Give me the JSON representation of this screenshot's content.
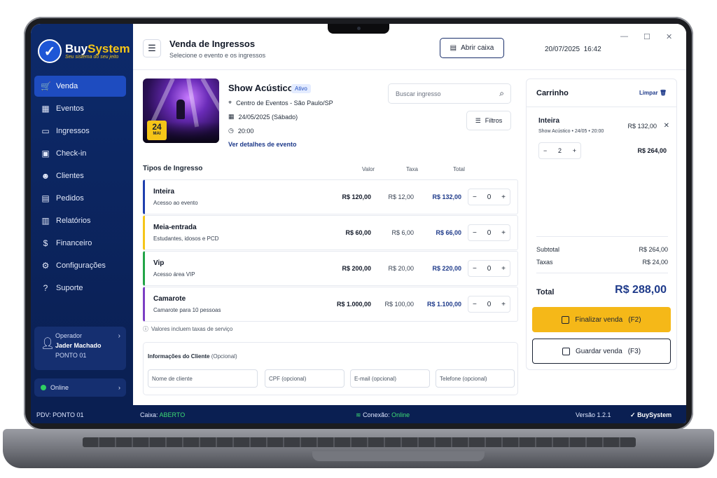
{
  "brand": {
    "name_part1": "Buy",
    "name_part2": "System",
    "tagline": "Seu sistema do seu jeito"
  },
  "sidebar": {
    "items": [
      {
        "label": "Venda",
        "icon": "cart-icon",
        "glyph": "🛒"
      },
      {
        "label": "Eventos",
        "icon": "calendar-plus-icon",
        "glyph": "▦"
      },
      {
        "label": "Ingressos",
        "icon": "ticket-icon",
        "glyph": "▭"
      },
      {
        "label": "Check-in",
        "icon": "checkin-icon",
        "glyph": "▣"
      },
      {
        "label": "Clientes",
        "icon": "users-icon",
        "glyph": "☻"
      },
      {
        "label": "Pedidos",
        "icon": "clipboard-icon",
        "glyph": "▤"
      },
      {
        "label": "Relatórios",
        "icon": "bar-chart-icon",
        "glyph": "▥"
      },
      {
        "label": "Financeiro",
        "icon": "dollar-icon",
        "glyph": "$"
      },
      {
        "label": "Configurações",
        "icon": "gear-icon",
        "glyph": "⚙"
      },
      {
        "label": "Suporte",
        "icon": "help-icon",
        "glyph": "?"
      }
    ],
    "active": "Venda",
    "operator": {
      "label": "Operador",
      "name": "Jader Machado",
      "station": "PONTO 01"
    },
    "status": "Online"
  },
  "header": {
    "title": "Venda de Ingressos",
    "subtitle": "Selecione o evento e os ingressos",
    "open_cash_label": "Abrir caixa",
    "date": "20/07/2025",
    "time": "16:42"
  },
  "event": {
    "title": "Show Acústico",
    "status": "Ativo",
    "badge_day": "24",
    "badge_month": "MAI",
    "venue": "Centro de Eventos - São Paulo/SP",
    "date": "24/05/2025 (Sábado)",
    "time": "20:00",
    "details_link": "Ver detalhes de evento"
  },
  "search": {
    "placeholder": "Buscar ingresso"
  },
  "filters_label": "Filtros",
  "tickets": {
    "section_title": "Tipos de Ingresso",
    "columns": {
      "value": "Valor",
      "fee": "Taxa",
      "total": "Total"
    },
    "rows": [
      {
        "name": "Inteira",
        "desc": "Acesso ao evento",
        "value": "R$ 120,00",
        "fee": "R$ 12,00",
        "total": "R$ 132,00",
        "qty": "0",
        "color": "#1e3fae"
      },
      {
        "name": "Meia-entrada",
        "desc": "Estudantes, idosos e PCD",
        "value": "R$ 60,00",
        "fee": "R$ 6,00",
        "total": "R$ 66,00",
        "qty": "0",
        "color": "#f5c518"
      },
      {
        "name": "Vip",
        "desc": "Acesso área VIP",
        "value": "R$ 200,00",
        "fee": "R$ 20,00",
        "total": "R$ 220,00",
        "qty": "0",
        "color": "#22a447"
      },
      {
        "name": "Camarote",
        "desc": "Camarote para 10 pessoas",
        "value": "R$ 1.000,00",
        "fee": "R$ 100,00",
        "total": "R$ 1.100,00",
        "qty": "0",
        "color": "#7b3fc4"
      }
    ],
    "note": "Valores incluem taxas de serviço"
  },
  "client": {
    "title": "Informações do Cliente",
    "optional": "(Opcional)",
    "fields": [
      "Nome de cliente",
      "CPF (opcional)",
      "E-mail (opcional)",
      "Telefone (opcional)"
    ]
  },
  "cart": {
    "title": "Carrinho",
    "clear_label": "Limpar",
    "item": {
      "name": "Inteira",
      "sub": "Show Acústico • 24/05 • 20:00",
      "unit_price": "R$ 132,00",
      "qty": "2",
      "subtotal": "R$ 264,00"
    },
    "subtotal_label": "Subtotal",
    "subtotal": "R$ 264,00",
    "fees_label": "Taxas",
    "fees": "R$ 24,00",
    "total_label": "Total",
    "total": "R$ 288,00",
    "finish_label": "Finalizar venda",
    "finish_key": "(F2)",
    "save_label": "Guardar venda",
    "save_key": "(F3)"
  },
  "statusbar": {
    "pdv": "PDV: PONTO 01",
    "caixa_label": "Caixa:",
    "caixa_value": "ABERTO",
    "conn_label": "Conexão:",
    "conn_value": "Online",
    "version": "Versão 1.2.1",
    "brand": "BuySystem"
  },
  "colors": {
    "sidebar": "#0d2a6b",
    "accent": "#1e4cc0",
    "primary_button": "#f5b818",
    "online": "#2fcf62"
  }
}
